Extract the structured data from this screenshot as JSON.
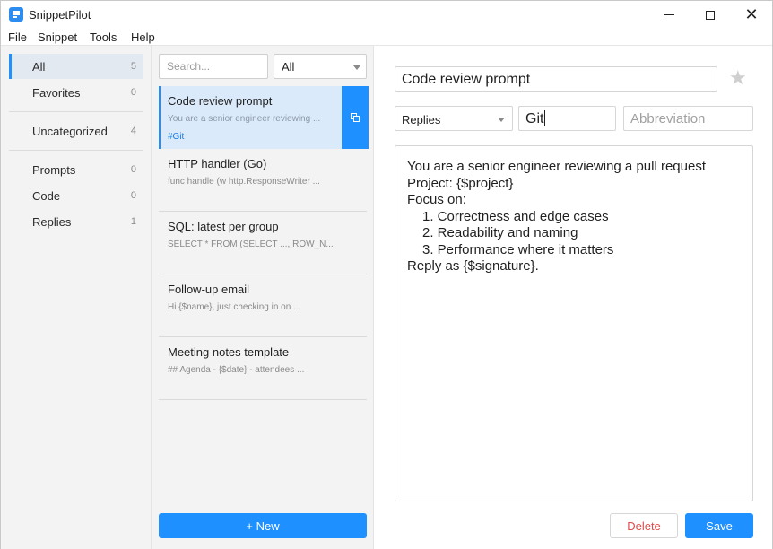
{
  "window": {
    "title": "SnippetPilot",
    "app_icon": "notes-icon",
    "controls": [
      "minimize-icon",
      "maximize-icon",
      "close-icon"
    ]
  },
  "menu": [
    "File",
    "Snippet",
    "Tools",
    "Help"
  ],
  "sidebar": {
    "groups": [
      [
        {
          "label": "All",
          "count": "5",
          "active": true
        },
        {
          "label": "Favorites",
          "count": "0"
        }
      ],
      [
        {
          "label": "Uncategorized",
          "count": "4"
        }
      ],
      [
        {
          "label": "Prompts",
          "count": "0"
        },
        {
          "label": "Code",
          "count": "0"
        },
        {
          "label": "Replies",
          "count": "1"
        }
      ]
    ]
  },
  "list": {
    "search_placeholder": "Search...",
    "filter_value": "All",
    "items": [
      {
        "title": "Code review prompt",
        "preview": "You are a senior engineer reviewing ...",
        "tag": "#Git",
        "selected": true
      },
      {
        "title": "HTTP handler (Go)",
        "preview": "func handle (w http.ResponseWriter ..."
      },
      {
        "title": "SQL: latest per group",
        "preview": "SELECT * FROM (SELECT ..., ROW_N..."
      },
      {
        "title": "Follow-up email",
        "preview": "Hi {$name}, just checking in on ..."
      },
      {
        "title": "Meeting notes template",
        "preview": "## Agenda - {$date} - attendees ..."
      }
    ],
    "copy_icon": "copy-icon",
    "new_button": "+ New"
  },
  "editor": {
    "title_value": "Code review prompt",
    "favorite_icon": "star-icon",
    "category_value": "Replies",
    "tags_value": "Git",
    "abbreviation_placeholder": "Abbreviation",
    "body_lines": [
      "You are a senior engineer reviewing a pull request",
      "Project: {$project}",
      "Focus on:"
    ],
    "body_list": [
      "1. Correctness and edge cases",
      "2. Readability and naming",
      "3. Performance where it matters"
    ],
    "body_footer": "Reply as {$signature}.",
    "delete_label": "Delete",
    "save_label": "Save"
  }
}
